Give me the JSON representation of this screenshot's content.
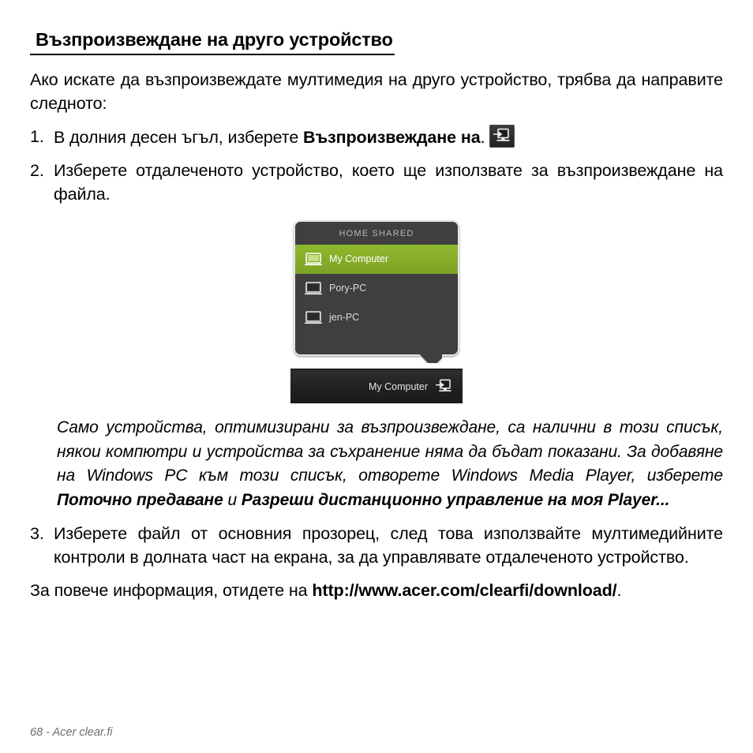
{
  "document": {
    "heading": "Възпроизвеждане на друго устройство",
    "intro": "Ако искате да възпроизвеждате мултимедия на друго устройство, трябва да направите следното:",
    "steps": [
      {
        "number": "1.",
        "text_before": "В долния десен ъгъл, изберете ",
        "bold": "Възпроизвеждане на",
        "text_after": ".",
        "icon": "play-to-icon"
      },
      {
        "number": "2.",
        "text_before": "Изберете отдалеченото устройство, което ще използвате за възпроизвеждане на файла.",
        "bold": "",
        "text_after": "",
        "icon": ""
      },
      {
        "number": "3.",
        "text_before": "Изберете файл от основния прозорец, след това използвайте мултимедийните контроли в долната част на екрана, за да управлявате отдалеченото устройство.",
        "bold": "",
        "text_after": "",
        "icon": ""
      }
    ],
    "note": {
      "part1": "Само устройства, оптимизирани за възпроизвеждане, са налични в този списък, някои компютри и устройства за съхранение няма да бъдат показани. За добавяне на Windows PC към този списък, отворете Windows Media Player, изберете ",
      "bold1": "Поточно предаване",
      "part2": " и ",
      "bold2": "Разреши дистанционно управление на моя Player...",
      "part3": ""
    },
    "closing": {
      "text_before": "За повече информация, отидете на ",
      "link": "http://www.acer.com/clearfi/download/",
      "text_after": "."
    },
    "footer": "68 - Acer clear.fi"
  },
  "screenshot": {
    "popup_header": "HOME SHARED",
    "devices": [
      {
        "label": "My Computer",
        "icon": "laptop-icon",
        "selected": true
      },
      {
        "label": "Pory-PC",
        "icon": "laptop-icon",
        "selected": false
      },
      {
        "label": "jen-PC",
        "icon": "laptop-icon",
        "selected": false
      }
    ],
    "bottom_bar": {
      "label": "My Computer",
      "icon": "play-to-icon"
    },
    "colors": {
      "selected_green": "#8fb92c",
      "popup_background": "#3f3f3f",
      "popup_border": "#e6e6e6",
      "bottom_bar": "#222222"
    }
  }
}
